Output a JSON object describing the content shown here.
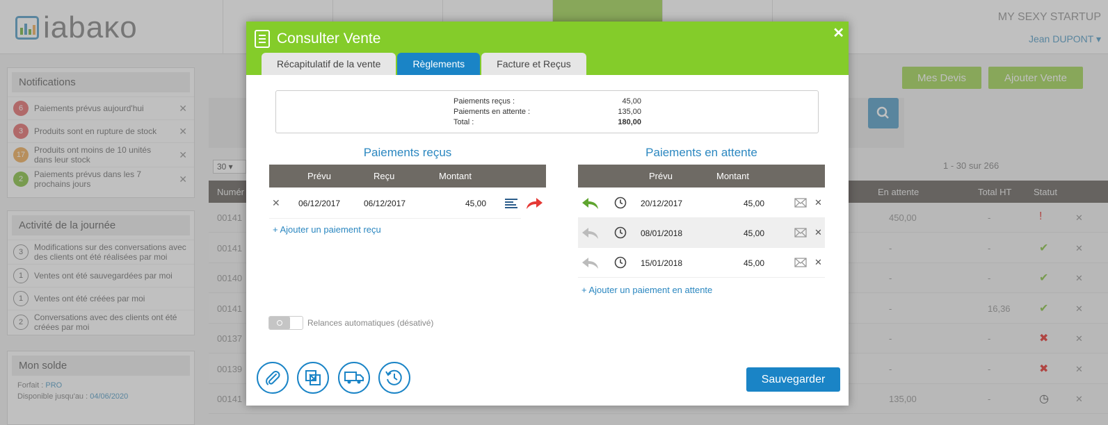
{
  "app": {
    "logo_text": "iabaκo",
    "company": "MY SEXY STARTUP",
    "user": "Jean DUPONT ▾"
  },
  "notifications": {
    "title": "Notifications",
    "items": [
      {
        "count": "6",
        "text": "Paiements prévus aujourd'hui",
        "color": "#e57373"
      },
      {
        "count": "3",
        "text": "Produits sont en rupture de stock",
        "color": "#e57373"
      },
      {
        "count": "17",
        "text": "Produits ont moins de 10 unités dans leur stock",
        "color": "#f0b060"
      },
      {
        "count": "2",
        "text": "Paiements prévus dans les 7 prochains jours",
        "color": "#8bc34a"
      }
    ]
  },
  "activity": {
    "title": "Activité de la journée",
    "items": [
      {
        "count": "3",
        "text": "Modifications sur des conversations avec des clients ont été réalisées par moi"
      },
      {
        "count": "1",
        "text": "Ventes ont été sauvegardées par moi"
      },
      {
        "count": "1",
        "text": "Ventes ont été créées par moi"
      },
      {
        "count": "2",
        "text": "Conversations avec des clients ont été créées par moi"
      }
    ]
  },
  "solde": {
    "title": "Mon solde",
    "forfait_label": "Forfait :",
    "forfait_value": "PRO",
    "dispo_label": "Disponible jusqu'au :",
    "dispo_value": "04/06/2020"
  },
  "background": {
    "btn_devis": "Mes Devis",
    "btn_ajouter": "Ajouter Vente",
    "page_size": "30 ▾",
    "pager": "1 - 30 sur 266",
    "columns": {
      "num": "Numér",
      "attente": "En attente",
      "total": "Total HT",
      "statut": "Statut"
    },
    "rows": [
      {
        "num": "00141",
        "attente": "450,00",
        "total": "-",
        "status": "error"
      },
      {
        "num": "00141",
        "attente": "-",
        "total": "-",
        "status": "ok"
      },
      {
        "num": "00140",
        "attente": "-",
        "total": "-",
        "status": "ok"
      },
      {
        "num": "00141",
        "attente": "-",
        "total": "16,36",
        "status": "ok"
      },
      {
        "num": "00137",
        "attente": "-",
        "total": "-",
        "status": "cancel"
      },
      {
        "num": "00139",
        "attente": "-",
        "total": "-",
        "status": "cancel"
      },
      {
        "num": "00141",
        "attente": "135,00",
        "total": "-",
        "status": "pending"
      }
    ]
  },
  "modal": {
    "title": "Consulter Vente",
    "close": "✕",
    "tabs": [
      {
        "label": "Récapitulatif de la vente",
        "active": false
      },
      {
        "label": "Règlements",
        "active": true
      },
      {
        "label": "Facture et Reçus",
        "active": false
      }
    ],
    "summary": {
      "recus_label": "Paiements reçus :",
      "recus_value": "45,00",
      "attente_label": "Paiements en attente :",
      "attente_value": "135,00",
      "total_label": "Total :",
      "total_value": "180,00"
    },
    "recus": {
      "title": "Paiements reçus",
      "headers": {
        "prevu": "Prévu",
        "recu": "Reçu",
        "montant": "Montant"
      },
      "rows": [
        {
          "prevu": "06/12/2017",
          "recu": "06/12/2017",
          "montant": "45,00"
        }
      ],
      "add_link": "+ Ajouter un paiement reçu"
    },
    "attente": {
      "title": "Paiements en attente",
      "headers": {
        "prevu": "Prévu",
        "montant": "Montant"
      },
      "rows": [
        {
          "prevu": "20/12/2017",
          "montant": "45,00",
          "highlight": true
        },
        {
          "prevu": "08/01/2018",
          "montant": "45,00",
          "highlight": false
        },
        {
          "prevu": "15/01/2018",
          "montant": "45,00",
          "highlight": false
        }
      ],
      "add_link": "+ Ajouter un paiement en attente"
    },
    "relances_label": "Relances automatiques (désativé)",
    "save_label": "Sauvegarder"
  },
  "colors": {
    "header_green": "#84cc2a",
    "tab_blue": "#1a84c6",
    "table_head": "#6e6a64",
    "arrow_red": "#e53935",
    "reply_green": "#5fa52f"
  }
}
